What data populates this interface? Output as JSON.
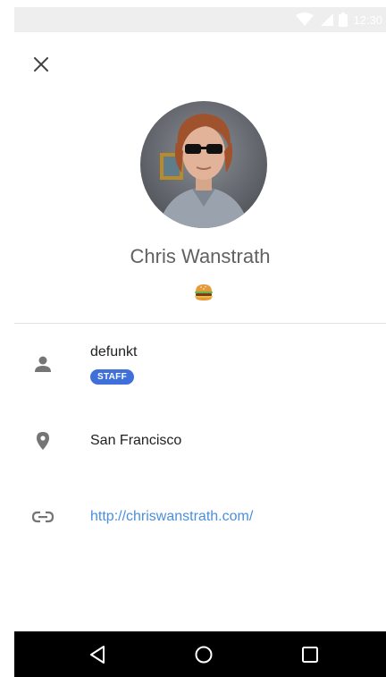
{
  "status_bar": {
    "time": "12:30",
    "icons": [
      "wifi-icon",
      "signal-icon",
      "battery-icon"
    ]
  },
  "header": {
    "close_icon": "close-icon"
  },
  "profile": {
    "name": "Chris Wanstrath",
    "status_emoji": "🍔"
  },
  "details": {
    "username": "defunkt",
    "badge": "STAFF",
    "location": "San Francisco",
    "website": "http://chriswanstrath.com/"
  },
  "navigation": {
    "buttons": [
      "back-icon",
      "home-icon",
      "recents-icon"
    ]
  },
  "colors": {
    "accent": "#3f6fd8",
    "link": "#4a8fdb",
    "icon": "#757575"
  }
}
